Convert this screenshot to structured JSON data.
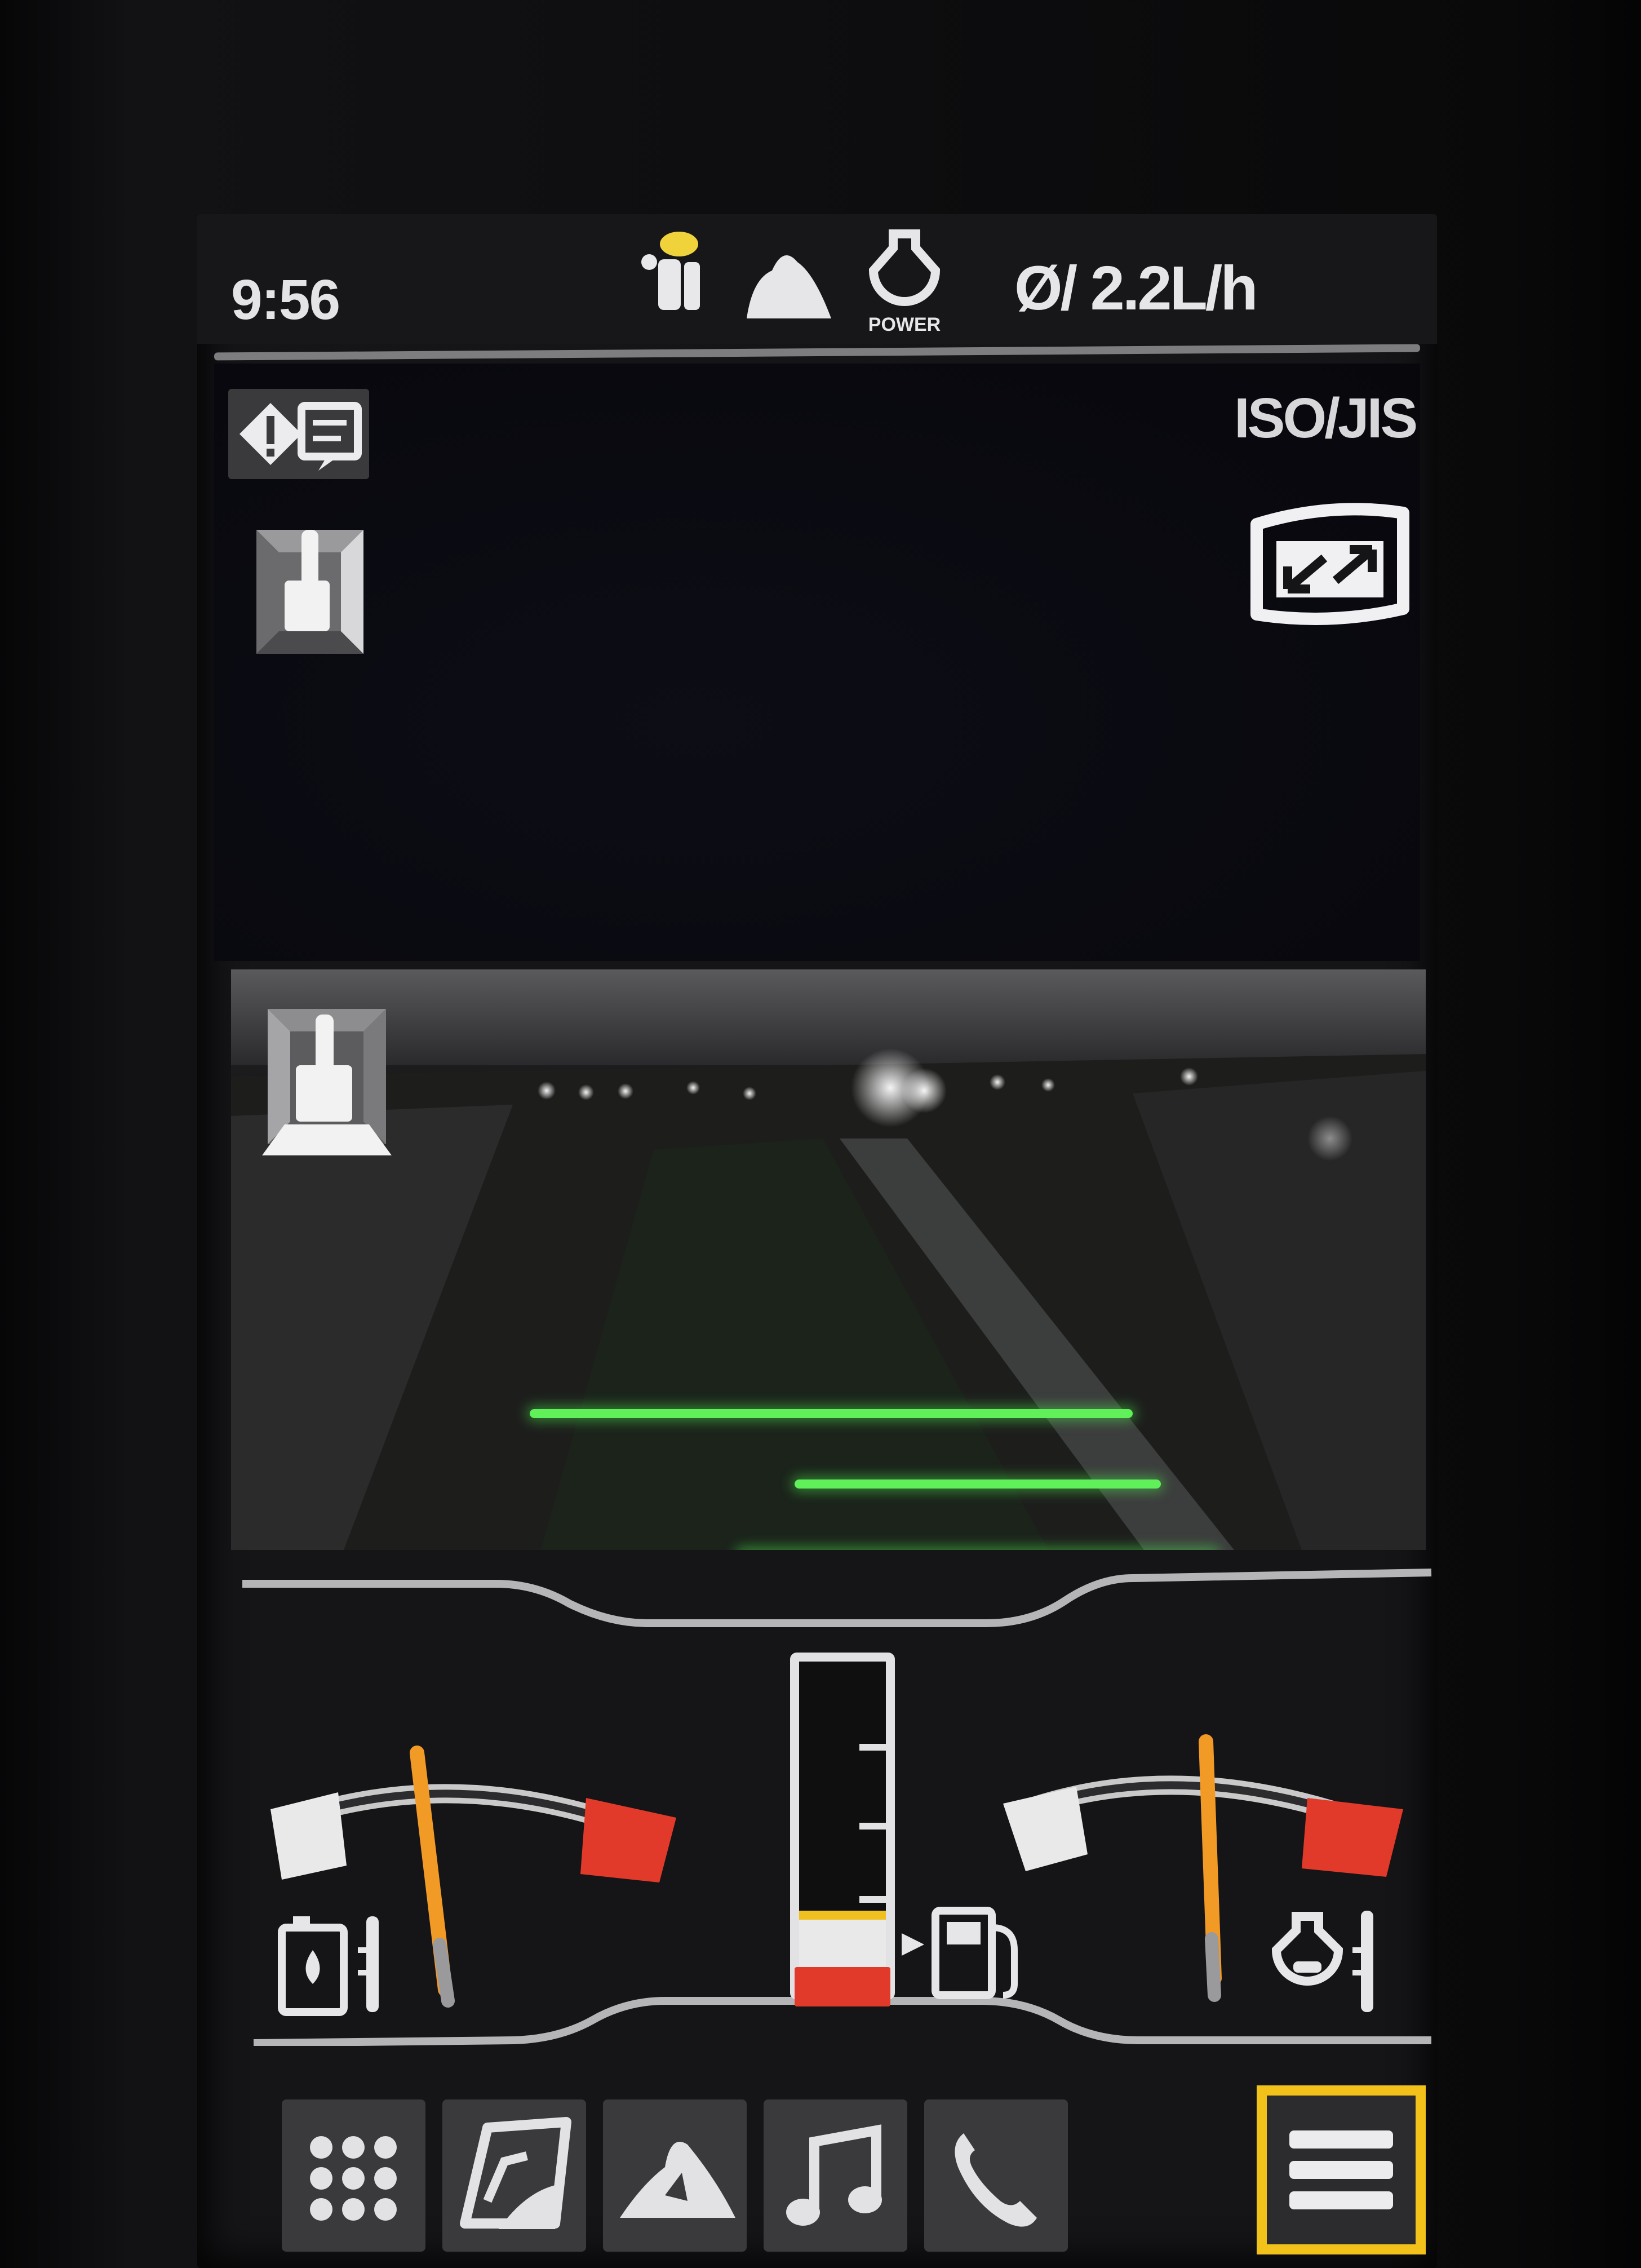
{
  "status_bar": {
    "time": "9:56",
    "fuel_rate": "Ø/ 2.2L/h",
    "icons": [
      "operator-worker-icon",
      "ground-dig-icon",
      "engine-power-icon"
    ],
    "power_mode_label": "POWER"
  },
  "camera_top": {
    "pattern_label": "ISO/JIS",
    "warning_button_icon": "warning-message-icon",
    "operation_pattern_icon": "joystick-pattern-icon",
    "expand_icon": "expand-screen-icon"
  },
  "camera_rear": {
    "pattern_icon": "joystick-rear-icon",
    "guide_line_color": "#5ff05a"
  },
  "gauges": {
    "coolant_temperature_level": 0.42,
    "hydraulic_oil_temperature_level": 0.53,
    "fuel_level": 0.18,
    "left_gauge_icon": "coolant-temperature-icon",
    "right_gauge_icon": "hydraulic-oil-temperature-icon",
    "fuel_icon": "fuel-pump-icon",
    "colors": {
      "normal": "#e9e9ea",
      "danger": "#e23a2a",
      "needle": "#f29a26",
      "fuel_low": "#f0c020"
    }
  },
  "tabs": [
    {
      "name": "apps-tab",
      "icon": "grid-icon"
    },
    {
      "name": "camera-tab",
      "icon": "camera-view-icon"
    },
    {
      "name": "work-mode-tab",
      "icon": "ground-dig-icon"
    },
    {
      "name": "audio-tab",
      "icon": "music-note-icon"
    },
    {
      "name": "phone-tab",
      "icon": "phone-icon"
    },
    {
      "name": "menu-tab",
      "icon": "hamburger-menu-icon",
      "selected": true,
      "highlight_color": "#f2c21a"
    }
  ]
}
